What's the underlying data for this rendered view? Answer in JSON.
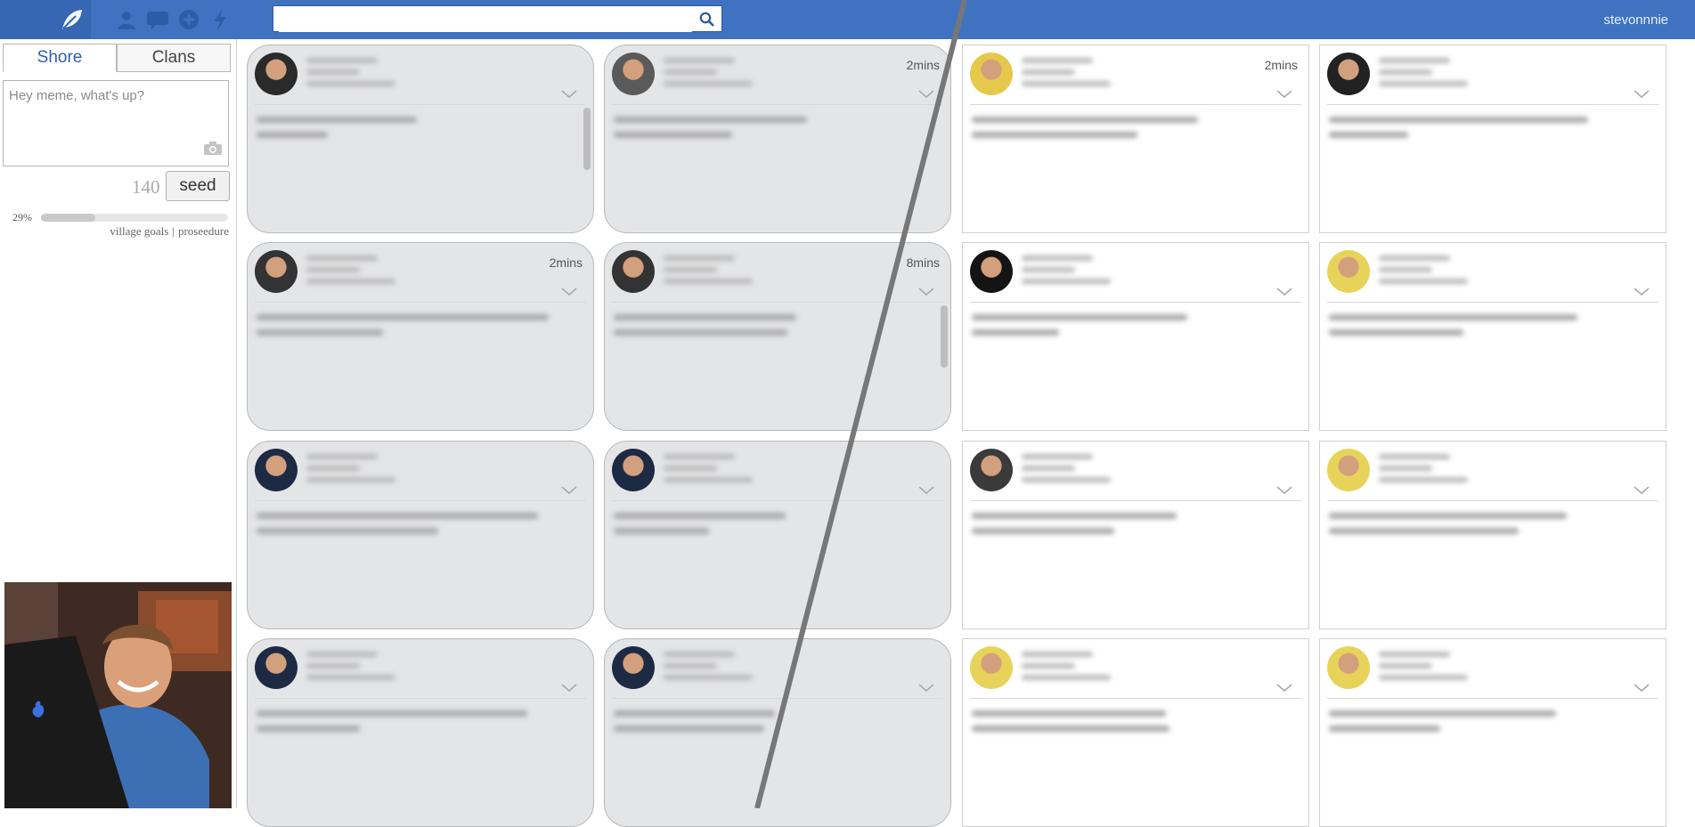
{
  "topbar": {
    "search_placeholder": "",
    "username": "stevonnnie",
    "nav_icons": [
      "leaf-icon",
      "user-icon",
      "chat-icon",
      "add-circle-icon",
      "lightning-icon",
      "search-icon"
    ]
  },
  "sidebar": {
    "tabs": [
      {
        "label": "Shore",
        "active": true
      },
      {
        "label": "Clans",
        "active": false
      }
    ],
    "compose_placeholder": "Hey meme, what's up?",
    "char_count": "140",
    "seed_label": "seed",
    "progress_label": "29%",
    "progress_value": 0.29,
    "goal_link_1": "village goals",
    "goal_separator": "|",
    "goal_link_2": "proseedure"
  },
  "feed": {
    "cards": [
      {
        "time": "",
        "style": "grey"
      },
      {
        "time": "2mins",
        "style": "grey"
      },
      {
        "time": "2mins",
        "style": "plain"
      },
      {
        "time": "",
        "style": "plain"
      },
      {
        "time": "2mins",
        "style": "grey"
      },
      {
        "time": "8mins",
        "style": "grey"
      },
      {
        "time": "",
        "style": "plain"
      },
      {
        "time": "",
        "style": "plain"
      },
      {
        "time": "",
        "style": "grey"
      },
      {
        "time": "",
        "style": "grey"
      },
      {
        "time": "",
        "style": "plain"
      },
      {
        "time": "",
        "style": "plain"
      },
      {
        "time": "",
        "style": "grey"
      },
      {
        "time": "",
        "style": "grey"
      },
      {
        "time": "",
        "style": "plain"
      },
      {
        "time": "",
        "style": "plain"
      }
    ]
  },
  "colors": {
    "topbar": "#3f73c1",
    "accent": "#2f5fae",
    "card_grey": "#e4e5e7"
  }
}
